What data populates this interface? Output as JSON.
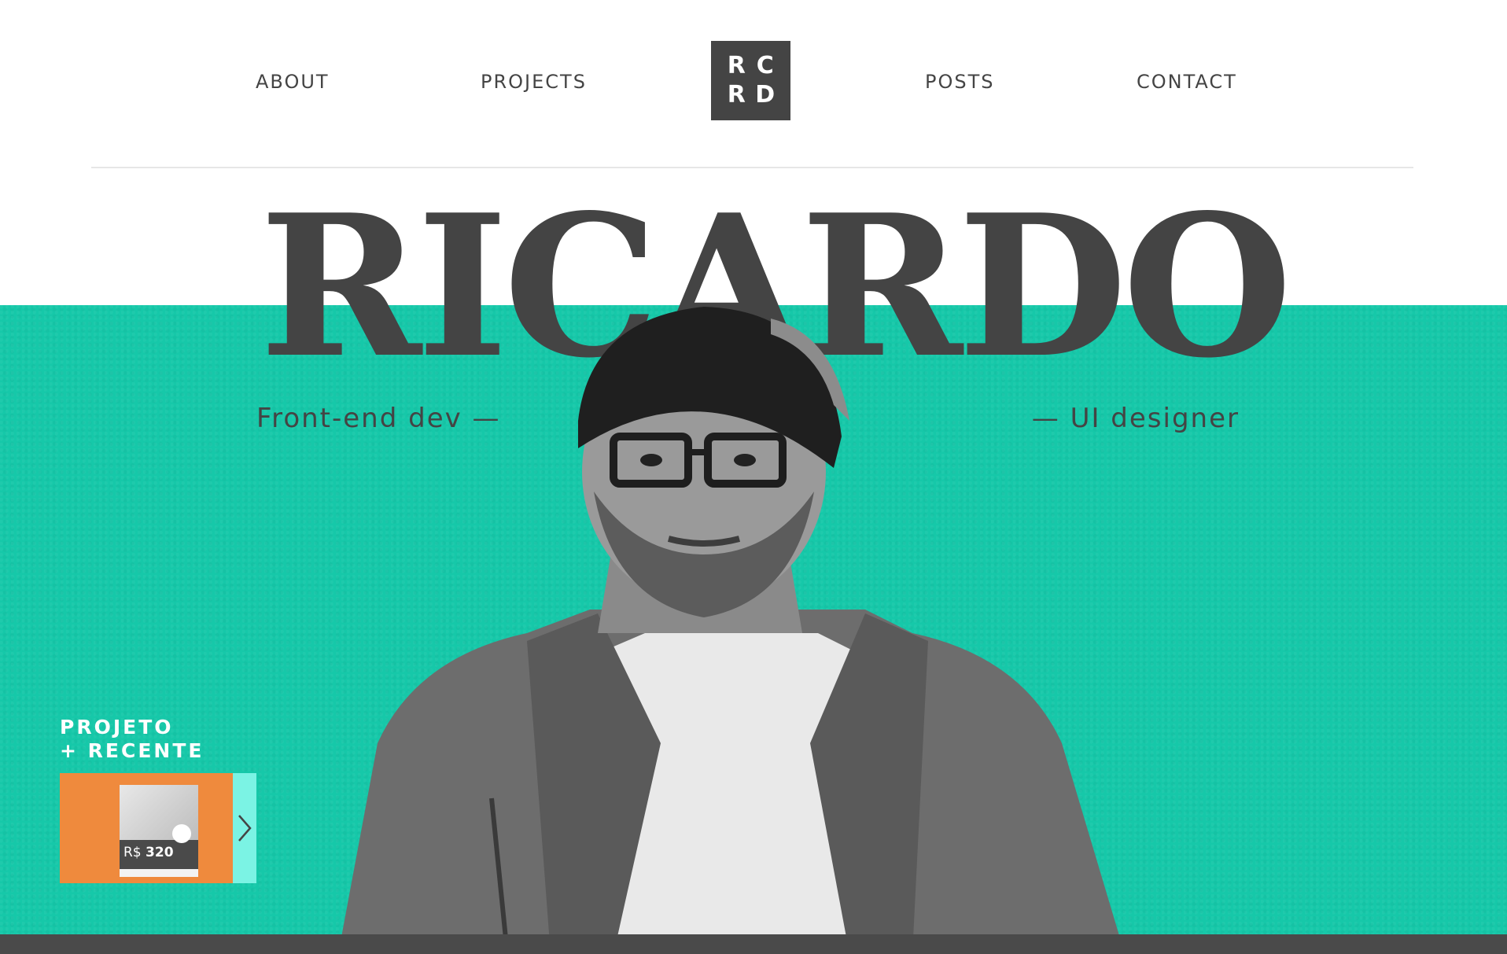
{
  "nav": {
    "about": "ABOUT",
    "projects": "PROJECTS",
    "posts": "POSTS",
    "contact": "CONTACT"
  },
  "logo": {
    "letters": [
      "R",
      "C",
      "R",
      "D"
    ]
  },
  "hero": {
    "name": "RICARDO",
    "tagline_left": "Front-end dev —",
    "tagline_right": "— UI designer"
  },
  "recent": {
    "label_line1": "PROJETO",
    "label_line2": "+ RECENTE",
    "thumb_price_currency": "R$",
    "thumb_price_value": "320"
  },
  "colors": {
    "accent": "#16c8a9",
    "dark": "#444444",
    "card": "#ef8a3d",
    "card_next": "#7bf3e4"
  },
  "icons": {
    "next": "chevron-right-icon"
  }
}
